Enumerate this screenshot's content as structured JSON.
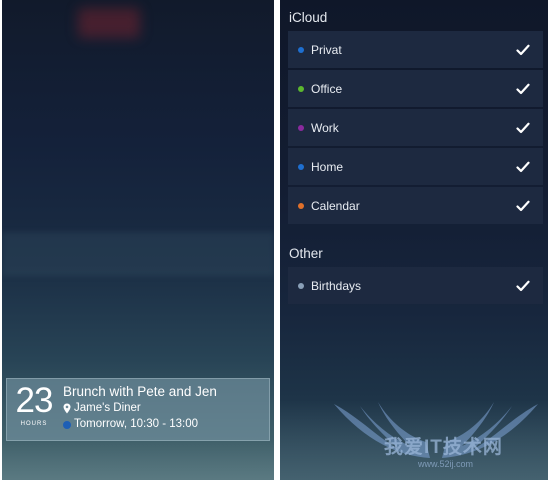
{
  "left": {
    "event": {
      "hours_value": "23",
      "hours_label": "HOURS",
      "title": "Brunch with Pete and Jen",
      "location": "Jame's Diner",
      "time": "Tomorrow, 10:30 - 13:00",
      "time_dot_color": "#1e5fb5"
    }
  },
  "right": {
    "icloud_title": "iCloud",
    "icloud_calendars": [
      {
        "name": "Privat",
        "color": "#1e6fd0",
        "checked": true
      },
      {
        "name": "Office",
        "color": "#5cb82e",
        "checked": true
      },
      {
        "name": "Work",
        "color": "#8a2a9e",
        "checked": true
      },
      {
        "name": "Home",
        "color": "#1e6fd0",
        "checked": true
      },
      {
        "name": "Calendar",
        "color": "#e0702a",
        "checked": true
      }
    ],
    "other_title": "Other",
    "other_calendars": [
      {
        "name": "Birthdays",
        "color": "#8aa0b8",
        "checked": true
      }
    ]
  },
  "watermark": {
    "text": "我爱IT技术网",
    "url": "www.52ij.com"
  },
  "icons": {
    "location": "location-pin-icon",
    "check": "checkmark-icon"
  }
}
